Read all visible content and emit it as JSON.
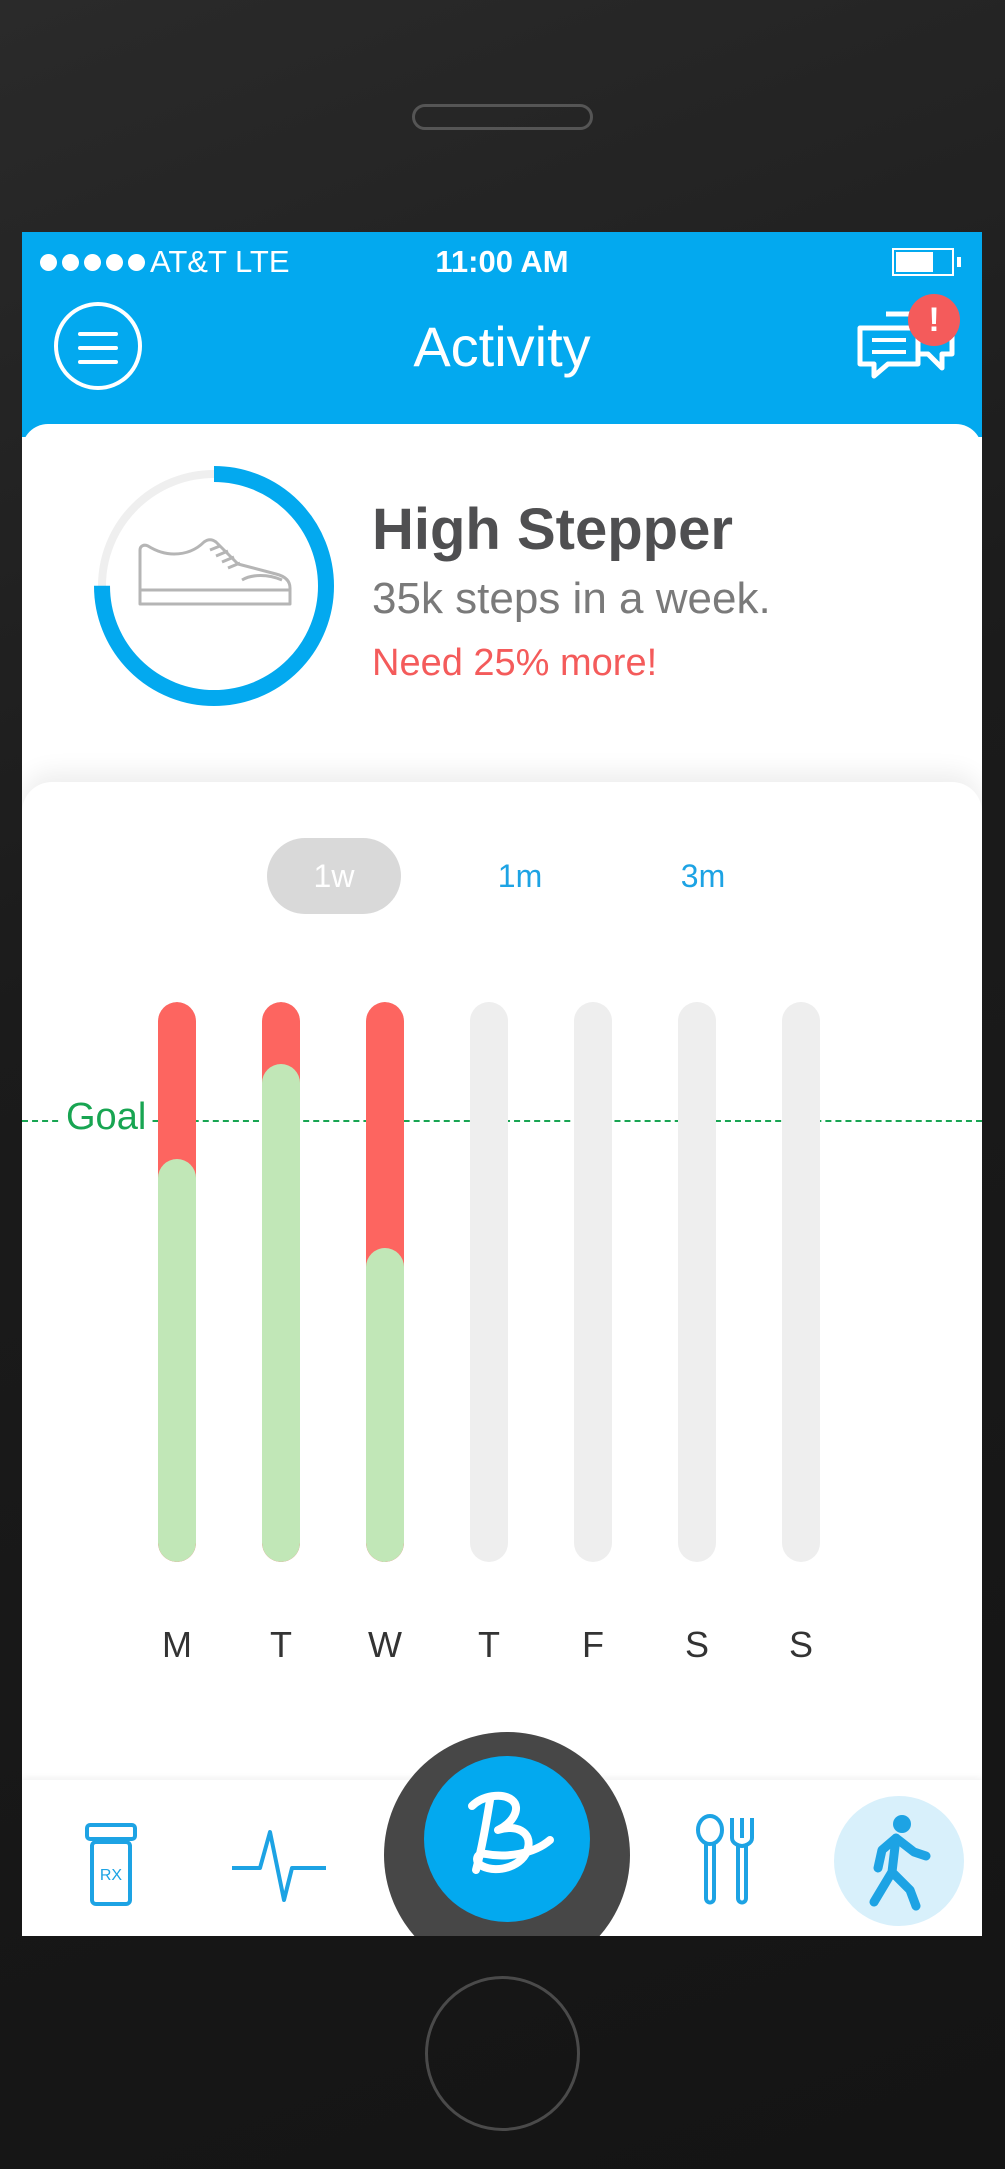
{
  "status_bar": {
    "carrier": "AT&T  LTE",
    "time": "11:00 AM"
  },
  "header": {
    "title": "Activity",
    "notification_badge": "!"
  },
  "achievement": {
    "title": "High Stepper",
    "description": "35k steps in a week.",
    "note": "Need 25% more!",
    "progress_percent": 75
  },
  "range_tabs": [
    {
      "label": "1w",
      "active": true
    },
    {
      "label": "1m",
      "active": false
    },
    {
      "label": "3m",
      "active": false
    }
  ],
  "chart_data": {
    "type": "bar",
    "categories": [
      "M",
      "T",
      "W",
      "T",
      "F",
      "S",
      "S"
    ],
    "goal_label": "Goal",
    "goal": 0.79,
    "series": [
      {
        "values": [
          0.72,
          0.89,
          0.56,
          0,
          0,
          0,
          0
        ]
      },
      {
        "values": [
          1.0,
          1.0,
          1.0,
          0,
          0,
          0,
          0
        ]
      }
    ],
    "ylim": [
      0,
      1
    ]
  },
  "tab_bar": {
    "items": [
      {
        "icon": "rx-bottle-icon",
        "label": "RX"
      },
      {
        "icon": "heartbeat-icon"
      },
      {
        "icon": "b-logo-icon"
      },
      {
        "icon": "spoon-fork-icon"
      },
      {
        "icon": "walking-person-icon",
        "active": true
      }
    ]
  },
  "colors": {
    "header": "#03a9ef",
    "accent_red": "#f45b5b",
    "goal_green": "#18a552",
    "progress_green": "#c1e7b7",
    "over_red": "#fd6560"
  }
}
